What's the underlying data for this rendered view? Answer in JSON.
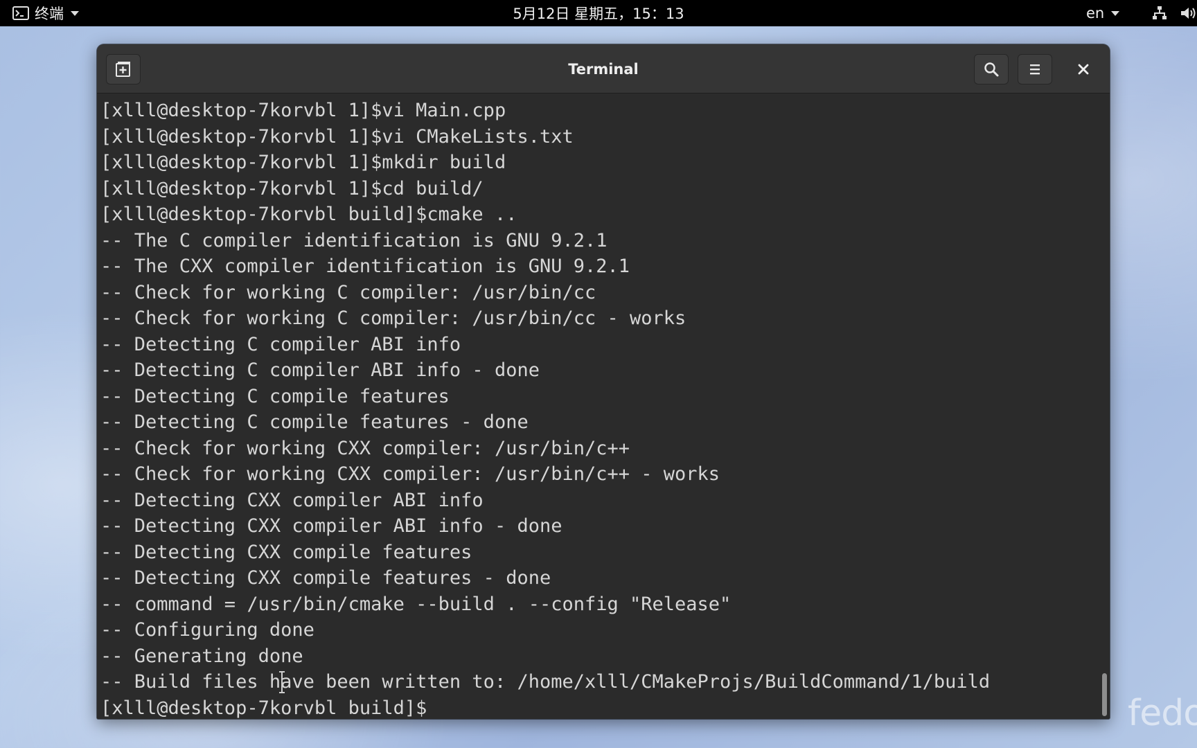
{
  "topbar": {
    "app_name": "终端",
    "clock": "5月12日 星期五，15：13",
    "language": "en"
  },
  "window": {
    "title": "Terminal"
  },
  "terminal": {
    "lines": [
      "[xlll@desktop-7korvbl 1]$vi Main.cpp",
      "[xlll@desktop-7korvbl 1]$vi CMakeLists.txt",
      "[xlll@desktop-7korvbl 1]$mkdir build",
      "[xlll@desktop-7korvbl 1]$cd build/",
      "[xlll@desktop-7korvbl build]$cmake ..",
      "-- The C compiler identification is GNU 9.2.1",
      "-- The CXX compiler identification is GNU 9.2.1",
      "-- Check for working C compiler: /usr/bin/cc",
      "-- Check for working C compiler: /usr/bin/cc - works",
      "-- Detecting C compiler ABI info",
      "-- Detecting C compiler ABI info - done",
      "-- Detecting C compile features",
      "-- Detecting C compile features - done",
      "-- Check for working CXX compiler: /usr/bin/c++",
      "-- Check for working CXX compiler: /usr/bin/c++ - works",
      "-- Detecting CXX compiler ABI info",
      "-- Detecting CXX compiler ABI info - done",
      "-- Detecting CXX compile features",
      "-- Detecting CXX compile features - done",
      "-- command = /usr/bin/cmake --build . --config \"Release\"",
      "-- Configuring done",
      "-- Generating done",
      "-- Build files have been written to: /home/xlll/CMakeProjs/BuildCommand/1/build",
      "[xlll@desktop-7korvbl build]$"
    ]
  },
  "desktop": {
    "watermark": "fedo"
  },
  "icons": {
    "app": "terminal-app-icon",
    "dropdown": "chevron-down-icon",
    "new_tab": "new-tab-icon",
    "search": "search-icon",
    "menu": "hamburger-menu-icon",
    "close": "close-icon",
    "network": "network-icon",
    "volume": "volume-icon",
    "text_cursor": "ibeam-cursor-icon"
  },
  "colors": {
    "topbar_bg": "#000000",
    "headerbar_bg": "#353535",
    "terminal_bg": "#2b2b2b",
    "terminal_fg": "#d6d6d6"
  }
}
